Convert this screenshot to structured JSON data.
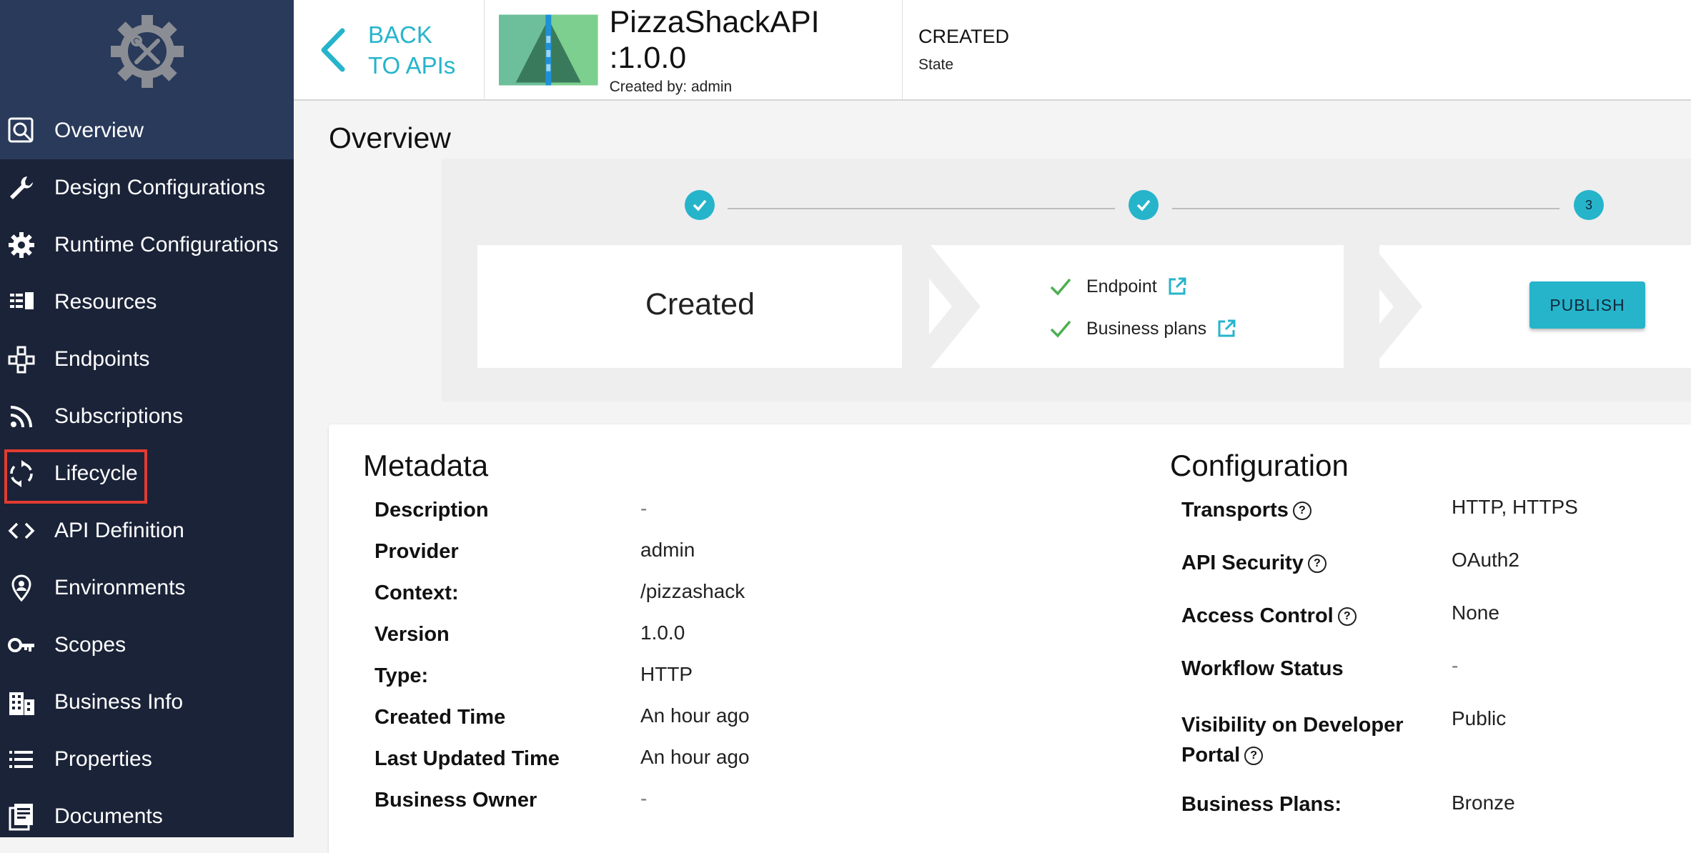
{
  "sidebar": {
    "items": [
      {
        "label": "Overview",
        "icon": "overview-icon"
      },
      {
        "label": "Design Configurations",
        "icon": "wrench-icon"
      },
      {
        "label": "Runtime Configurations",
        "icon": "gear-icon"
      },
      {
        "label": "Resources",
        "icon": "resources-icon"
      },
      {
        "label": "Endpoints",
        "icon": "endpoints-icon"
      },
      {
        "label": "Subscriptions",
        "icon": "rss-icon"
      },
      {
        "label": "Lifecycle",
        "icon": "lifecycle-icon"
      },
      {
        "label": "API Definition",
        "icon": "code-icon"
      },
      {
        "label": "Environments",
        "icon": "location-icon"
      },
      {
        "label": "Scopes",
        "icon": "key-icon"
      },
      {
        "label": "Business Info",
        "icon": "building-icon"
      },
      {
        "label": "Properties",
        "icon": "list-icon"
      },
      {
        "label": "Documents",
        "icon": "documents-icon"
      }
    ]
  },
  "header": {
    "back_label": "BACK TO APIs",
    "api_name": "PizzaShackAPI :1.0.0",
    "created_by": "Created by: admin",
    "state_value": "CREATED",
    "state_label": "State"
  },
  "main": {
    "title": "Overview",
    "lifecycle": {
      "step3_number": "3",
      "current_state": "Created",
      "requirements": [
        {
          "label": "Endpoint"
        },
        {
          "label": "Business plans"
        }
      ],
      "publish_label": "PUBLISH"
    },
    "metadata": {
      "title": "Metadata",
      "rows": [
        {
          "label": "Description",
          "value": "-"
        },
        {
          "label": "Provider",
          "value": "admin"
        },
        {
          "label": "Context:",
          "value": "/pizzashack"
        },
        {
          "label": "Version",
          "value": "1.0.0"
        },
        {
          "label": "Type:",
          "value": "HTTP"
        },
        {
          "label": "Created Time",
          "value": "An hour ago"
        },
        {
          "label": "Last Updated Time",
          "value": "An hour ago"
        },
        {
          "label": "Business Owner",
          "value": "-"
        }
      ]
    },
    "configuration": {
      "title": "Configuration",
      "rows": [
        {
          "label": "Transports",
          "value": "HTTP, HTTPS"
        },
        {
          "label": "API Security",
          "value": "OAuth2"
        },
        {
          "label": "Access Control",
          "value": "None"
        },
        {
          "label": "Workflow Status",
          "value": "-"
        },
        {
          "label": "Visibility on Developer",
          "label2": "Portal",
          "value": "Public"
        },
        {
          "label": "Business Plans:",
          "value": "Bronze"
        }
      ]
    }
  },
  "colors": {
    "sidebar_bg": "#1b2338",
    "sidebar_active": "#293a5a",
    "accent": "#26b4cb",
    "check_green": "#4caf50",
    "highlight_red": "#e33b31"
  }
}
